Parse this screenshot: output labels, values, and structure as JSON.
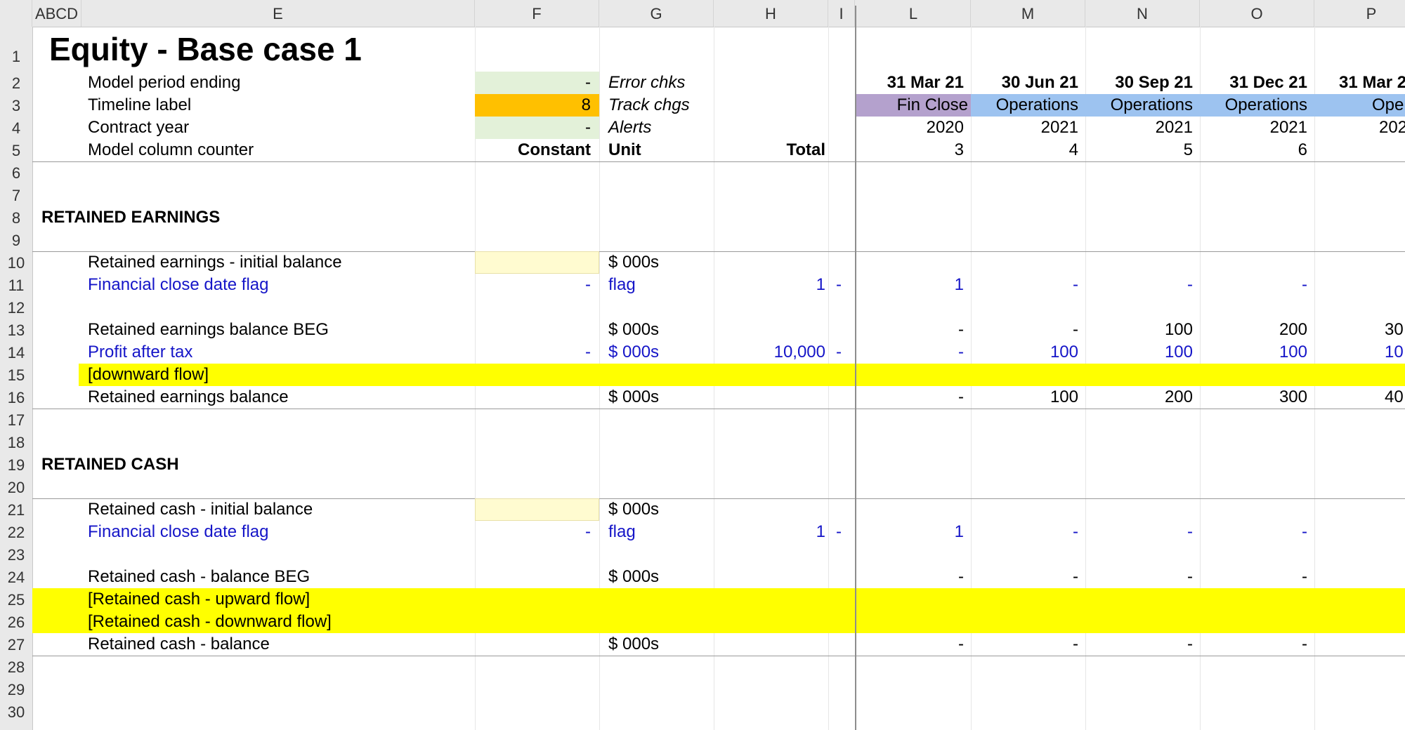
{
  "columns": [
    "ABCD",
    "E",
    "F",
    "G",
    "H",
    "I",
    "L",
    "M",
    "N",
    "O",
    "P"
  ],
  "title": "Equity - Base case 1",
  "colors": {
    "green_input": "#e3f1d9",
    "orange_input": "#ffc000",
    "yellow_input": "#fffbd0",
    "flow": "#ffff00",
    "fin_close": "#b4a1cd",
    "operations": "#9dc3f0"
  },
  "header": {
    "model_period_ending": "Model period ending",
    "timeline_label": "Timeline label",
    "contract_year": "Contract year",
    "model_column_counter": "Model column counter",
    "f2": "-",
    "f3": "8",
    "f4": "-",
    "error_chks": "Error chks",
    "track_chgs": "Track chgs",
    "alerts": "Alerts",
    "constant": "Constant",
    "unit": "Unit",
    "total": "Total",
    "dates": [
      "31 Mar 21",
      "30 Jun 21",
      "30 Sep 21",
      "31 Dec 21",
      "31 Mar 2"
    ],
    "phases": [
      "Fin Close",
      "Operations",
      "Operations",
      "Operations",
      "Operatio"
    ],
    "years": [
      "2020",
      "2021",
      "2021",
      "2021",
      "202"
    ],
    "counters": [
      "3",
      "4",
      "5",
      "6",
      ""
    ]
  },
  "row_numbers": [
    "1",
    "2",
    "3",
    "4",
    "5",
    "6",
    "7",
    "8",
    "9",
    "10",
    "11",
    "12",
    "13",
    "14",
    "15",
    "16",
    "17",
    "18",
    "19",
    "20",
    "21",
    "22",
    "23",
    "24",
    "25",
    "26",
    "27",
    "28",
    "29",
    "30"
  ],
  "sections": {
    "retained_earnings": "RETAINED EARNINGS",
    "retained_cash": "RETAINED CASH"
  },
  "re": {
    "initial_label": "Retained earnings - initial balance",
    "initial_unit": "$ 000s",
    "flag_label": "Financial close date flag",
    "flag_const": "-",
    "flag_unit": "flag",
    "flag_total": "1",
    "flag_i": "-",
    "flag_vals": [
      "1",
      "-",
      "-",
      "-"
    ],
    "beg_label": "Retained earnings balance BEG",
    "beg_unit": "$ 000s",
    "beg_vals": [
      "-",
      "-",
      "100",
      "200",
      "30"
    ],
    "pat_label": "Profit after tax",
    "pat_const": "-",
    "pat_unit": "$ 000s",
    "pat_total": "10,000",
    "pat_i": "-",
    "pat_vals": [
      "-",
      "100",
      "100",
      "100",
      "10"
    ],
    "down_label": "[downward flow]",
    "bal_label": "Retained earnings balance",
    "bal_unit": "$ 000s",
    "bal_vals": [
      "-",
      "100",
      "200",
      "300",
      "40"
    ]
  },
  "rc": {
    "initial_label": "Retained cash - initial balance",
    "initial_unit": "$ 000s",
    "flag_label": "Financial close date flag",
    "flag_const": "-",
    "flag_unit": "flag",
    "flag_total": "1",
    "flag_i": "-",
    "flag_vals": [
      "1",
      "-",
      "-",
      "-"
    ],
    "beg_label": "Retained cash - balance BEG",
    "beg_unit": "$ 000s",
    "beg_vals": [
      "-",
      "-",
      "-",
      "-"
    ],
    "up_label": "[Retained cash - upward flow]",
    "down_label": "[Retained cash - downward flow]",
    "bal_label": "Retained cash - balance",
    "bal_unit": "$ 000s",
    "bal_vals": [
      "-",
      "-",
      "-",
      "-"
    ]
  }
}
